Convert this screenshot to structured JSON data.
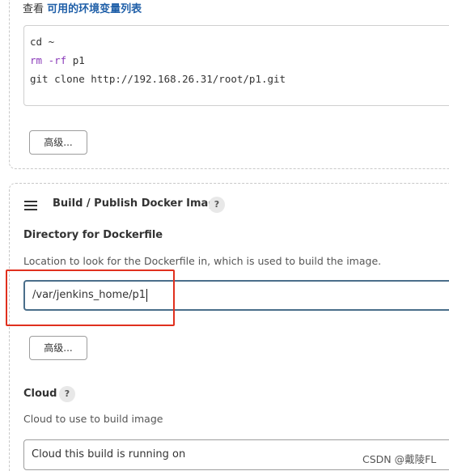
{
  "env_vars_line": {
    "prefix": "查看 ",
    "link": "可用的环境变量列表"
  },
  "shell_script": {
    "line1": "cd ~",
    "line2_cmd": "rm",
    "line2_flag": " -rf",
    "line2_arg": " p1",
    "line3": "git clone http://192.168.26.31/root/p1.git"
  },
  "advanced_button_1": "高级...",
  "docker_step": {
    "title": "Build / Publish Docker Image",
    "help": "?",
    "dockerfile_label": "Directory for Dockerfile",
    "dockerfile_desc": "Location to look for the Dockerfile in, which is used to build the image.",
    "dockerfile_value": "/var/jenkins_home/p1",
    "advanced_button": "高级...",
    "cloud_label": "Cloud",
    "cloud_help": "?",
    "cloud_desc": "Cloud to use to build image",
    "cloud_value": "Cloud this build is running on"
  },
  "watermark": "CSDN @戴陵FL",
  "colors": {
    "link": "#1f5fa8",
    "focus_border": "#4a6e8a",
    "highlight": "#e0301e",
    "keyword": "#8a3ab9"
  }
}
